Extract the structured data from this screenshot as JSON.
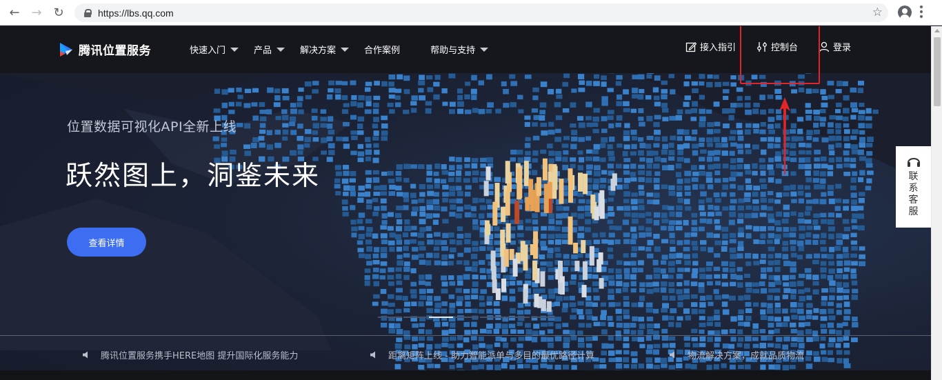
{
  "browser": {
    "url": "https://lbs.qq.com",
    "icons": [
      "back-icon",
      "forward-icon",
      "reload-icon",
      "lock-icon",
      "star-icon",
      "profile-icon",
      "menu-icon"
    ]
  },
  "header": {
    "brand": "腾讯位置服务",
    "menu": [
      {
        "label": "快速入门",
        "dropdown": true
      },
      {
        "label": "产品",
        "dropdown": true
      },
      {
        "label": "解决方案",
        "dropdown": true
      },
      {
        "label": "合作案例",
        "dropdown": false
      },
      {
        "label": "帮助与支持",
        "dropdown": true
      }
    ],
    "guide": "接入指引",
    "console": "控制台",
    "login": "登录"
  },
  "hero": {
    "subtitle": "位置数据可视化API全新上线",
    "title": "跃然图上，洞鉴未来",
    "cta": "查看详情"
  },
  "contact": {
    "label": "联系客服"
  },
  "carousel": {
    "slides": 7,
    "active": 2
  },
  "news": [
    "腾讯位置服务携手HERE地图 提升国际化服务能力",
    "距离矩阵上线 - 助力智能派单与多目的最优路径计算",
    "物流解决方案，成就品质物流"
  ],
  "colors": {
    "accent": "#3d6df0",
    "annotation": "#e1262a",
    "header_bg": "#16171d",
    "map_tile": "#2f6fb4"
  }
}
